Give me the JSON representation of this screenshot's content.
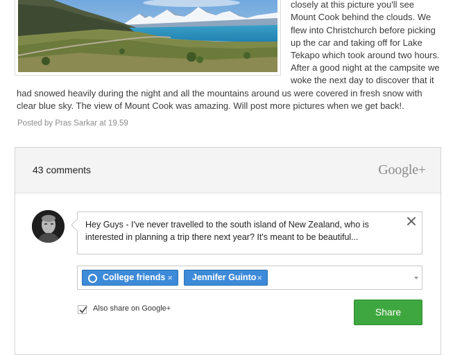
{
  "post": {
    "lines_right": [
      "closely at this picture you'll see",
      "Mount Cook behind the clouds. We",
      "flew into Christchurch before picking",
      "up the car and taking off for Lake",
      "Tekapo which took around two hours.",
      "After a good night at the campsite we",
      "woke the next day to discover that it"
    ],
    "lines_full": [
      "had snowed heavily during the night and all the mountains around us were covered in fresh snow with",
      "clear blue sky. The view of Mount Cook was amazing. Will post more pictures when we get back!."
    ],
    "meta": "Posted by Pras Sarkar at 19.59"
  },
  "comments": {
    "count_label": "43 comments",
    "brand": "Google+",
    "draft_lines": [
      "Hey Guys - I've never travelled to the south island of New Zealand, who is",
      "interested in planning a trip there next year? It's meant to be beautiful..."
    ],
    "close_symbol": "✕",
    "share_with": [
      {
        "label": "College friends",
        "remove": "×",
        "icon": "circle-icon"
      },
      {
        "label": "Jennifer Guinto",
        "remove": "×"
      }
    ],
    "also_share_label": "Also share on Google+",
    "also_share_checked": true,
    "share_button": "Share"
  },
  "colors": {
    "chip_blue": "#3d8ad8",
    "share_green": "#3fa73f",
    "header_gray": "#f4f4f4"
  }
}
